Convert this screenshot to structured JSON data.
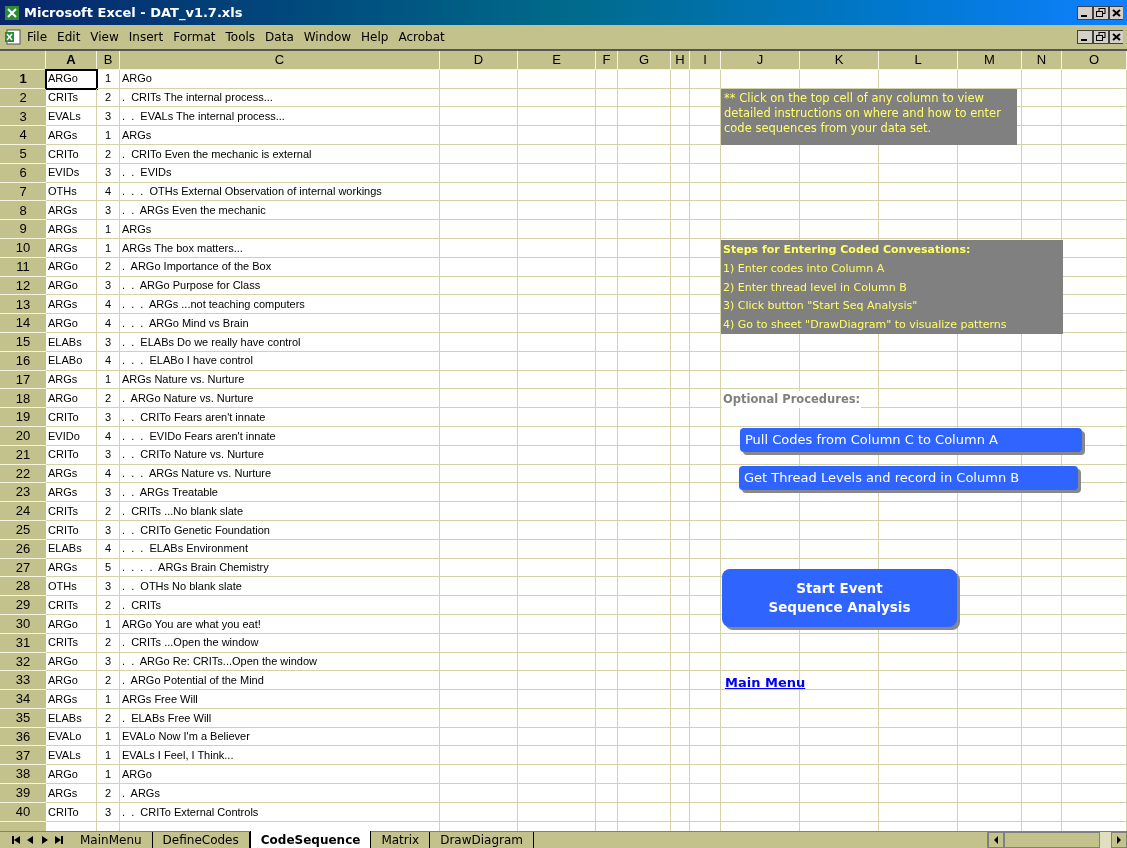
{
  "window": {
    "title": "Microsoft Excel - DAT_v1.7.xls"
  },
  "menu": [
    "File",
    "Edit",
    "View",
    "Insert",
    "Format",
    "Tools",
    "Data",
    "Window",
    "Help",
    "Acrobat"
  ],
  "columns": [
    {
      "label": "A",
      "selected": true
    },
    {
      "label": "B",
      "selected": false
    },
    {
      "label": "C",
      "selected": false
    },
    {
      "label": "D",
      "selected": false
    },
    {
      "label": "E",
      "selected": false
    },
    {
      "label": "F",
      "selected": false
    },
    {
      "label": "G",
      "selected": false
    },
    {
      "label": "H",
      "selected": false
    },
    {
      "label": "I",
      "selected": false
    },
    {
      "label": "J",
      "selected": false
    },
    {
      "label": "K",
      "selected": false
    },
    {
      "label": "L",
      "selected": false
    },
    {
      "label": "M",
      "selected": false
    },
    {
      "label": "N",
      "selected": false
    },
    {
      "label": "O",
      "selected": false
    }
  ],
  "rows": [
    {
      "n": "1",
      "a": "ARGo",
      "b": "1",
      "c": "ARGo",
      "selected": true
    },
    {
      "n": "2",
      "a": "CRITs",
      "b": "2",
      "c": ".  CRITs The internal process...",
      "selected": false
    },
    {
      "n": "3",
      "a": "EVALs",
      "b": "3",
      "c": ".  .  EVALs The internal process...",
      "selected": false
    },
    {
      "n": "4",
      "a": "ARGs",
      "b": "1",
      "c": "ARGs",
      "selected": false
    },
    {
      "n": "5",
      "a": "CRITo",
      "b": "2",
      "c": ".  CRITo Even the mechanic is external",
      "selected": false
    },
    {
      "n": "6",
      "a": "EVIDs",
      "b": "3",
      "c": ".  .  EVIDs",
      "selected": false
    },
    {
      "n": "7",
      "a": "OTHs",
      "b": "4",
      "c": ".  .  .  OTHs External Observation of internal workings",
      "selected": false
    },
    {
      "n": "8",
      "a": "ARGs",
      "b": "3",
      "c": ".  .  ARGs Even the mechanic",
      "selected": false
    },
    {
      "n": "9",
      "a": "ARGs",
      "b": "1",
      "c": "ARGs",
      "selected": false
    },
    {
      "n": "10",
      "a": "ARGs",
      "b": "1",
      "c": "ARGs The box matters...",
      "selected": false
    },
    {
      "n": "11",
      "a": "ARGo",
      "b": "2",
      "c": ".  ARGo Importance of the Box",
      "selected": false
    },
    {
      "n": "12",
      "a": "ARGo",
      "b": "3",
      "c": ".  .  ARGo Purpose for Class",
      "selected": false
    },
    {
      "n": "13",
      "a": "ARGs",
      "b": "4",
      "c": ".  .  .  ARGs ...not teaching computers",
      "selected": false
    },
    {
      "n": "14",
      "a": "ARGo",
      "b": "4",
      "c": ".  .  .  ARGo Mind vs Brain",
      "selected": false
    },
    {
      "n": "15",
      "a": "ELABs",
      "b": "3",
      "c": ".  .  ELABs Do we really have control",
      "selected": false
    },
    {
      "n": "16",
      "a": "ELABo",
      "b": "4",
      "c": ".  .  .  ELABo I have control",
      "selected": false
    },
    {
      "n": "17",
      "a": "ARGs",
      "b": "1",
      "c": "ARGs Nature vs. Nurture",
      "selected": false
    },
    {
      "n": "18",
      "a": "ARGo",
      "b": "2",
      "c": ".  ARGo Nature vs. Nurture",
      "selected": false
    },
    {
      "n": "19",
      "a": "CRITo",
      "b": "3",
      "c": ".  .  CRITo Fears aren't innate",
      "selected": false
    },
    {
      "n": "20",
      "a": "EVIDo",
      "b": "4",
      "c": ".  .  .  EVIDo Fears aren't innate",
      "selected": false
    },
    {
      "n": "21",
      "a": "CRITo",
      "b": "3",
      "c": ".  .  CRITo Nature vs. Nurture",
      "selected": false
    },
    {
      "n": "22",
      "a": "ARGs",
      "b": "4",
      "c": ".  .  .  ARGs Nature vs. Nurture",
      "selected": false
    },
    {
      "n": "23",
      "a": "ARGs",
      "b": "3",
      "c": ".  .  ARGs Treatable",
      "selected": false
    },
    {
      "n": "24",
      "a": "CRITs",
      "b": "2",
      "c": ".  CRITs ...No blank slate",
      "selected": false
    },
    {
      "n": "25",
      "a": "CRITo",
      "b": "3",
      "c": ".  .  CRITo Genetic Foundation",
      "selected": false
    },
    {
      "n": "26",
      "a": "ELABs",
      "b": "4",
      "c": ".  .  .  ELABs Environment",
      "selected": false
    },
    {
      "n": "27",
      "a": "ARGs",
      "b": "5",
      "c": ".  .  .  .  ARGs Brain Chemistry",
      "selected": false
    },
    {
      "n": "28",
      "a": "OTHs",
      "b": "3",
      "c": ".  .  OTHs No blank slate",
      "selected": false
    },
    {
      "n": "29",
      "a": "CRITs",
      "b": "2",
      "c": ".  CRITs",
      "selected": false
    },
    {
      "n": "30",
      "a": "ARGo",
      "b": "1",
      "c": "ARGo You are what you eat!",
      "selected": false
    },
    {
      "n": "31",
      "a": "CRITs",
      "b": "2",
      "c": ".  CRITs ...Open the window",
      "selected": false
    },
    {
      "n": "32",
      "a": "ARGo",
      "b": "3",
      "c": ".  .  ARGo Re: CRITs...Open the window",
      "selected": false
    },
    {
      "n": "33",
      "a": "ARGo",
      "b": "2",
      "c": ".  ARGo Potential of the Mind",
      "selected": false
    },
    {
      "n": "34",
      "a": "ARGs",
      "b": "1",
      "c": "ARGs Free Will",
      "selected": false
    },
    {
      "n": "35",
      "a": "ELABs",
      "b": "2",
      "c": ".  ELABs Free Will",
      "selected": false
    },
    {
      "n": "36",
      "a": "EVALo",
      "b": "1",
      "c": "EVALo Now I'm a Believer",
      "selected": false
    },
    {
      "n": "37",
      "a": "EVALs",
      "b": "1",
      "c": "EVALs I Feel, I Think...",
      "selected": false
    },
    {
      "n": "38",
      "a": "ARGo",
      "b": "1",
      "c": "ARGo",
      "selected": false
    },
    {
      "n": "39",
      "a": "ARGs",
      "b": "2",
      "c": ".  ARGs",
      "selected": false
    },
    {
      "n": "40",
      "a": "CRITo",
      "b": "3",
      "c": ".  .  CRITo External Controls",
      "selected": false
    }
  ],
  "note": "** Click on the top cell of any column to view detailed instructions on where and how to enter code sequences from your data set.",
  "steps": {
    "title": "Steps for Entering Coded Convesations:",
    "items": [
      "1) Enter codes into Column A",
      "2) Enter thread level in Column B",
      "3) Click button \"Start Seq Analysis\"",
      "4) Go to sheet \"DrawDiagram\" to visualize patterns"
    ]
  },
  "optional_label": "Optional Procedures:",
  "buttons": [
    "Pull Codes from Column C to Column A",
    "Get Thread Levels and record in Column B"
  ],
  "start_button": [
    "Start Event",
    "Sequence Analysis"
  ],
  "main_menu_link": "Main Menu",
  "sheet_tabs": [
    {
      "label": "MainMenu",
      "selected": false
    },
    {
      "label": "DefineCodes",
      "selected": false
    },
    {
      "label": "CodeSequence",
      "selected": true
    },
    {
      "label": "Matrix",
      "selected": false
    },
    {
      "label": "DrawDiagram",
      "selected": false
    }
  ]
}
